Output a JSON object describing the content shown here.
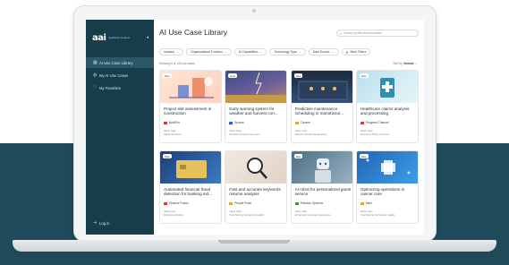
{
  "app": {
    "logo_mark": "aai",
    "logo_text": "appliedAI Institute"
  },
  "sidebar": {
    "collapse_icon": "collapse-icon",
    "items": [
      {
        "label": "AI Use Case Library",
        "icon": "grid-icon",
        "active": true
      },
      {
        "label": "My AI Use Cases",
        "icon": "user-icon",
        "active": false
      },
      {
        "label": "My Favorites",
        "icon": "heart-icon",
        "active": false
      }
    ],
    "logout_label": "Log in"
  },
  "header": {
    "title": "AI Use Case Library",
    "search_placeholder": "Search by title and description"
  },
  "filters": [
    {
      "label": "Industry"
    },
    {
      "label": "Organizational Function"
    },
    {
      "label": "AI Capabilities"
    },
    {
      "label": "Technology Type"
    },
    {
      "label": "Data Source"
    }
  ],
  "more_filters_label": "More Filters",
  "listing": {
    "showing_text": "Showing 8 of 135 use cases",
    "sort_label": "Sort by:",
    "sort_value": "Newest"
  },
  "cards": [
    {
      "badge": "New",
      "title": "Project risk assessment in construction",
      "company": "BuildPro",
      "flag_color": "#d9342b",
      "meta_label": "Value Gain",
      "meta_value": "Digital Services"
    },
    {
      "badge": "New",
      "title": "Early warning system for weather and harvest corr...",
      "company": "Sunera",
      "flag_color": "#2a5bd7",
      "meta_label": "Value Gain",
      "meta_value": "Weather Forecast Services"
    },
    {
      "badge": "New",
      "title": "Predictive maintenance scheduling in manufactur...",
      "company": "Chrome",
      "flag_color": "#e0a82b",
      "meta_label": "Value Gain",
      "meta_value": "Machine Model Maintenance"
    },
    {
      "badge": "New",
      "title": "Healthcare claims analysis and processing",
      "company": "Progress Channel",
      "flag_color": "#d9342b",
      "meta_label": "Value Gain",
      "meta_value": "Insurance Policy Services"
    },
    {
      "badge": "New",
      "title": "Automated financial fraud detection for banking ind...",
      "company": "Finance Fusion",
      "flag_color": "#d9342b",
      "meta_label": "Value Gain",
      "meta_value": "Enhanced Quality"
    },
    {
      "badge": "",
      "title": "Fast and accurate keywords resume analysis",
      "company": "People Pulse",
      "flag_color": "#e0a82b",
      "meta_label": "Value Gain",
      "meta_value": "Cost Saving, Enhanced Quality"
    },
    {
      "badge": "New",
      "title": "AI robot for personalized guest service",
      "company": "Robotics Systems",
      "flag_color": "#3a8f3a",
      "meta_label": "Value Gain",
      "meta_value": "Enhanced Customer Experience"
    },
    {
      "badge": "New",
      "title": "Optimizing operations in cancer care",
      "company": "Mavi",
      "flag_color": "#e0a82b",
      "meta_label": "Value Gain",
      "meta_value": "Cost Saving, Enhanced Quality"
    }
  ]
}
